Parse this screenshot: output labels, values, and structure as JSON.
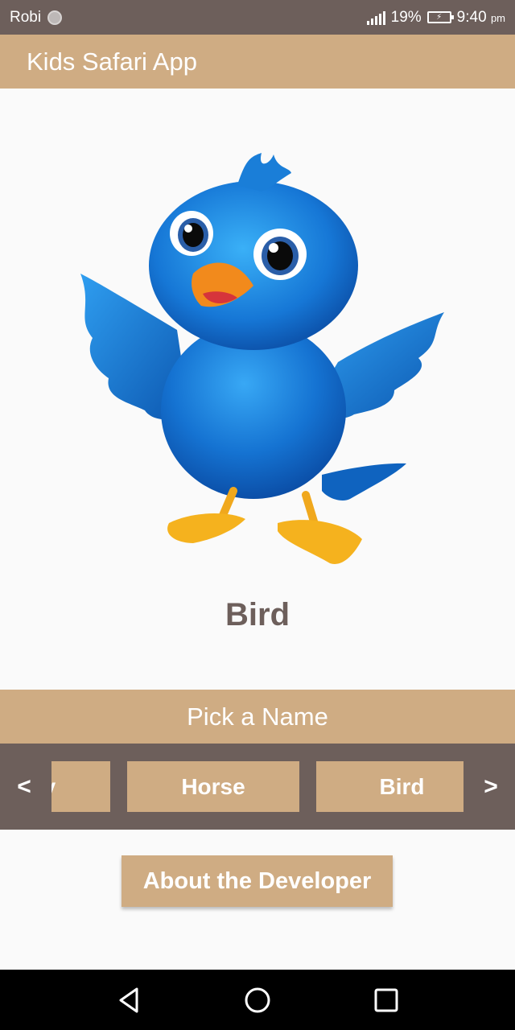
{
  "status_bar": {
    "carrier": "Robi",
    "battery_percent": "19%",
    "time": "9:40",
    "time_suffix": "pm",
    "icons": [
      "sim-icon",
      "signal-icon",
      "battery-icon"
    ]
  },
  "app_bar": {
    "title": "Kids Safari App"
  },
  "main": {
    "image_icon": "blue-bird-cartoon",
    "animal_name": "Bird"
  },
  "picker": {
    "header": "Pick a Name",
    "prev_label": "<",
    "next_label": ">",
    "items": [
      "ey",
      "Horse",
      "Bird"
    ]
  },
  "about_button_label": "About the Developer",
  "colors": {
    "primary": "#cfac83",
    "dark": "#6d5f5b",
    "background": "#fafafa",
    "bird_blue": "#1b7fd8"
  },
  "nav_bar": {
    "icons": [
      "back-icon",
      "home-icon",
      "recents-icon"
    ]
  }
}
